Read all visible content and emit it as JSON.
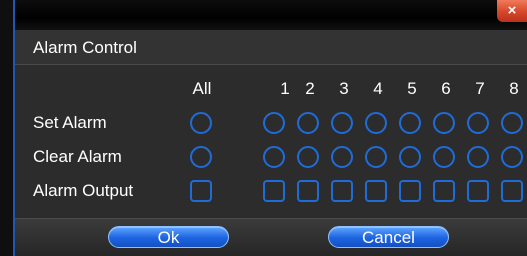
{
  "dialog": {
    "title": "Alarm Control",
    "close_icon": "×",
    "accent_color": "#1f6cd8"
  },
  "columns": {
    "all": "All",
    "channels": [
      "1",
      "2",
      "3",
      "4",
      "5",
      "6",
      "7",
      "8"
    ]
  },
  "rows": [
    {
      "label": "Set Alarm",
      "control": "radio"
    },
    {
      "label": "Clear Alarm",
      "control": "radio"
    },
    {
      "label": "Alarm Output",
      "control": "checkbox"
    }
  ],
  "buttons": {
    "ok": "Ok",
    "cancel": "Cancel"
  }
}
